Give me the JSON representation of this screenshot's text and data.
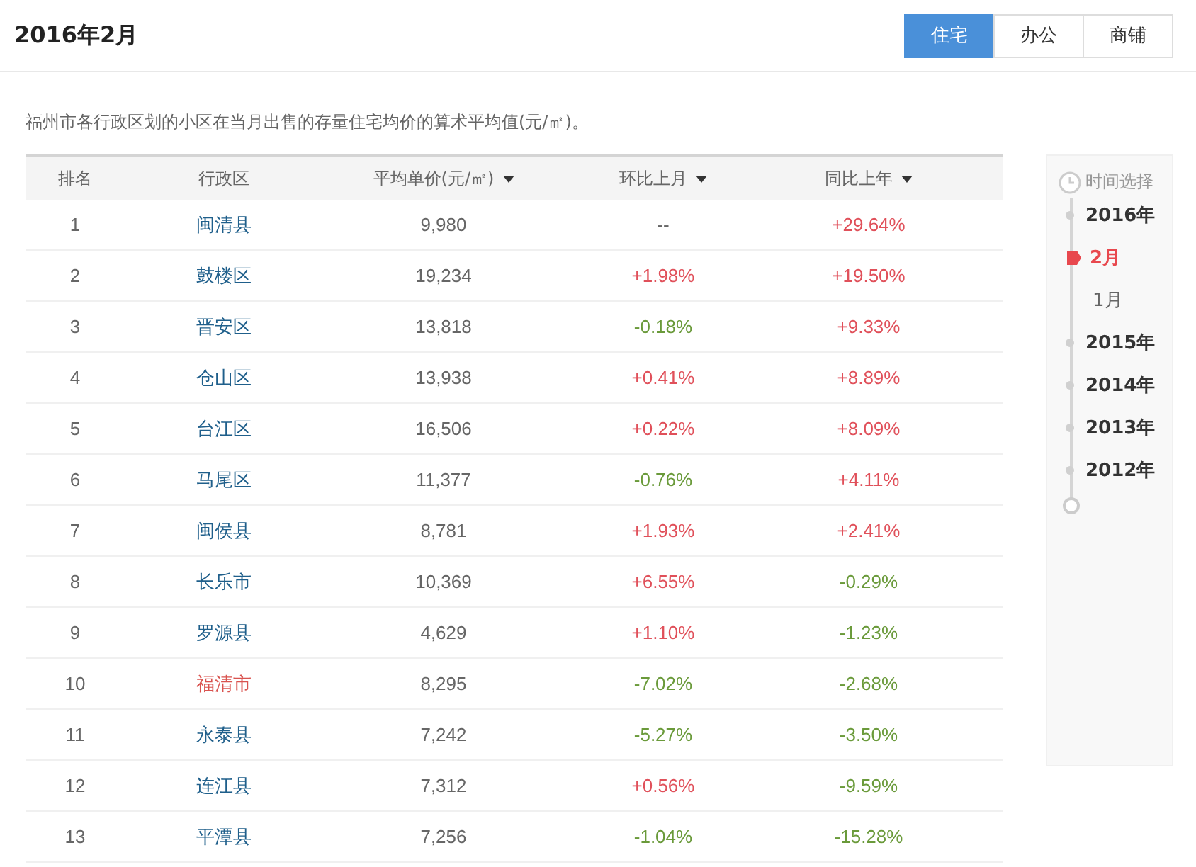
{
  "header": {
    "title": "2016年2月"
  },
  "tabs": [
    {
      "label": "住宅",
      "selected": true
    },
    {
      "label": "办公",
      "selected": false
    },
    {
      "label": "商铺",
      "selected": false
    }
  ],
  "description": "福州市各行政区划的小区在当月出售的存量住宅均价的算术平均值(元/㎡)。",
  "table": {
    "columns": [
      {
        "label": "排名",
        "sortable": false
      },
      {
        "label": "行政区",
        "sortable": false
      },
      {
        "label": "平均单价(元/㎡)",
        "sortable": true
      },
      {
        "label": "环比上月",
        "sortable": true
      },
      {
        "label": "同比上年",
        "sortable": true
      }
    ],
    "rows": [
      {
        "rank": "1",
        "district": "闽清县",
        "highlighted": false,
        "price": "9,980",
        "mom": {
          "text": "--",
          "color": "#666666"
        },
        "yoy": {
          "text": "+29.64%",
          "color": "#e0505a"
        }
      },
      {
        "rank": "2",
        "district": "鼓楼区",
        "highlighted": false,
        "price": "19,234",
        "mom": {
          "text": "+1.98%",
          "color": "#e0505a"
        },
        "yoy": {
          "text": "+19.50%",
          "color": "#e0505a"
        }
      },
      {
        "rank": "3",
        "district": "晋安区",
        "highlighted": false,
        "price": "13,818",
        "mom": {
          "text": "-0.18%",
          "color": "#6a9a3a"
        },
        "yoy": {
          "text": "+9.33%",
          "color": "#e0505a"
        }
      },
      {
        "rank": "4",
        "district": "仓山区",
        "highlighted": false,
        "price": "13,938",
        "mom": {
          "text": "+0.41%",
          "color": "#e0505a"
        },
        "yoy": {
          "text": "+8.89%",
          "color": "#e0505a"
        }
      },
      {
        "rank": "5",
        "district": "台江区",
        "highlighted": false,
        "price": "16,506",
        "mom": {
          "text": "+0.22%",
          "color": "#e0505a"
        },
        "yoy": {
          "text": "+8.09%",
          "color": "#e0505a"
        }
      },
      {
        "rank": "6",
        "district": "马尾区",
        "highlighted": false,
        "price": "11,377",
        "mom": {
          "text": "-0.76%",
          "color": "#6a9a3a"
        },
        "yoy": {
          "text": "+4.11%",
          "color": "#e0505a"
        }
      },
      {
        "rank": "7",
        "district": "闽侯县",
        "highlighted": false,
        "price": "8,781",
        "mom": {
          "text": "+1.93%",
          "color": "#e0505a"
        },
        "yoy": {
          "text": "+2.41%",
          "color": "#e0505a"
        }
      },
      {
        "rank": "8",
        "district": "长乐市",
        "highlighted": false,
        "price": "10,369",
        "mom": {
          "text": "+6.55%",
          "color": "#e0505a"
        },
        "yoy": {
          "text": "-0.29%",
          "color": "#6a9a3a"
        }
      },
      {
        "rank": "9",
        "district": "罗源县",
        "highlighted": false,
        "price": "4,629",
        "mom": {
          "text": "+1.10%",
          "color": "#e0505a"
        },
        "yoy": {
          "text": "-1.23%",
          "color": "#6a9a3a"
        }
      },
      {
        "rank": "10",
        "district": "福清市",
        "highlighted": true,
        "price": "8,295",
        "mom": {
          "text": "-7.02%",
          "color": "#6a9a3a"
        },
        "yoy": {
          "text": "-2.68%",
          "color": "#6a9a3a"
        }
      },
      {
        "rank": "11",
        "district": "永泰县",
        "highlighted": false,
        "price": "7,242",
        "mom": {
          "text": "-5.27%",
          "color": "#6a9a3a"
        },
        "yoy": {
          "text": "-3.50%",
          "color": "#6a9a3a"
        }
      },
      {
        "rank": "12",
        "district": "连江县",
        "highlighted": false,
        "price": "7,312",
        "mom": {
          "text": "+0.56%",
          "color": "#e0505a"
        },
        "yoy": {
          "text": "-9.59%",
          "color": "#6a9a3a"
        }
      },
      {
        "rank": "13",
        "district": "平潭县",
        "highlighted": false,
        "price": "7,256",
        "mom": {
          "text": "-1.04%",
          "color": "#6a9a3a"
        },
        "yoy": {
          "text": "-15.28%",
          "color": "#6a9a3a"
        }
      }
    ]
  },
  "timeline": {
    "title": "时间选择",
    "years": [
      {
        "label": "2016年",
        "children": [
          {
            "label": "2月",
            "selected": true
          },
          {
            "label": "1月",
            "selected": false
          }
        ]
      },
      {
        "label": "2015年"
      },
      {
        "label": "2014年"
      },
      {
        "label": "2013年"
      },
      {
        "label": "2012年"
      }
    ]
  }
}
